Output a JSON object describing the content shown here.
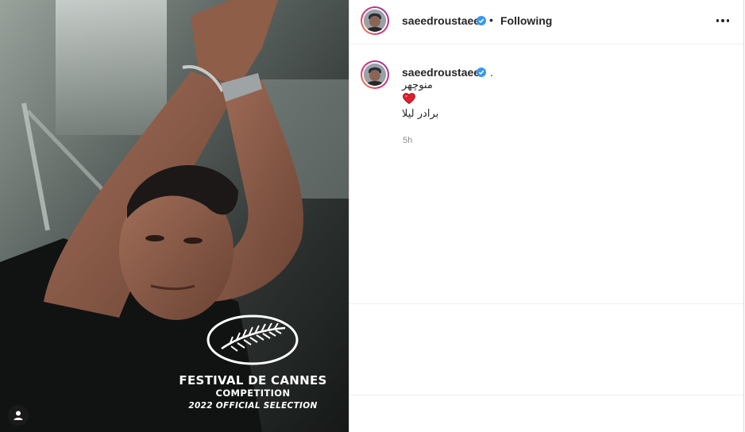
{
  "post": {
    "overlay": {
      "line1": "FESTIVAL DE CANNES",
      "line2": "COMPETITION",
      "line3": "2022 OFFICIAL SELECTION"
    },
    "user_tag_icon": "person-icon"
  },
  "header": {
    "username": "saeedroustaee",
    "verified_icon": "verified-badge-icon",
    "separator": "•",
    "follow_status": "Following",
    "more_icon": "more-horizontal-icon"
  },
  "caption": {
    "username": "saeedroustaee",
    "trailing": ".",
    "line1": "منوچهر",
    "heart_icon": "red-heart-emoji",
    "line2": "برادر لیلا",
    "time": "5h"
  },
  "colors": {
    "verified": "#3897f0",
    "heart": "#e0202d",
    "muted_text": "#8e8e8e",
    "border": "#dbdbdb"
  }
}
